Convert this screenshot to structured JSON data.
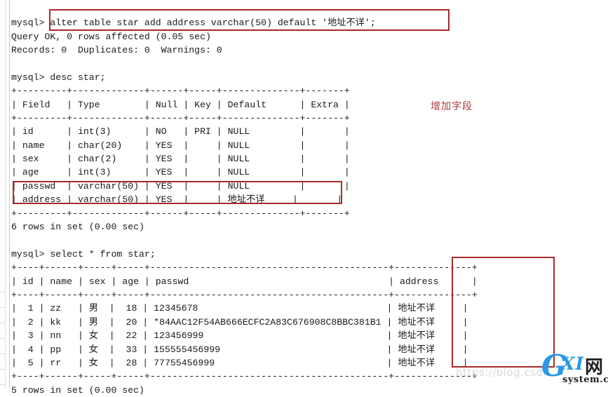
{
  "colors": {
    "background": "#ffffff",
    "text": "#1a1a1a",
    "annotation_red": "#a82a2a",
    "annotation_label": "#b03a3a",
    "watermark_blue": "#2a97e8",
    "watermark_gray": "#d8d8d8"
  },
  "terminal": {
    "lines": [
      "mysql> alter table star add address varchar(50) default '地址不详';",
      "Query OK, 0 rows affected (0.05 sec)",
      "Records: 0  Duplicates: 0  Warnings: 0",
      "",
      "mysql> desc star;",
      "+---------+-------------+------+-----+--------------+-------+",
      "| Field   | Type        | Null | Key | Default      | Extra |",
      "+---------+-------------+------+-----+--------------+-------+",
      "| id      | int(3)      | NO   | PRI | NULL         |       |",
      "| name    | char(20)    | YES  |     | NULL         |       |",
      "| sex     | char(2)     | YES  |     | NULL         |       |",
      "| age     | int(3)      | YES  |     | NULL         |       |",
      "| passwd  | varchar(50) | YES  |     | NULL         |       |",
      "| address | varchar(50) | YES  |     | 地址不详     |       |",
      "+---------+-------------+------+-----+--------------+-------+",
      "6 rows in set (0.00 sec)",
      "",
      "mysql> select * from star;",
      "+----+------+-----+-----+-------------------------------------------+--------------+",
      "| id | name | sex | age | passwd                                    | address      |",
      "+----+------+-----+-----+-------------------------------------------+--------------+",
      "|  1 | zz   | 男  |  18 | 12345678                                  | 地址不详     |",
      "|  2 | kk   | 男  |  20 | *84AAC12F54AB666ECFC2A83C676908C8BBC381B1 | 地址不详     |",
      "|  3 | nn   | 女  |  22 | 123456999                                 | 地址不详     |",
      "|  4 | pp   | 女  |  33 | 155555456999                              | 地址不详     |",
      "|  5 | rr   | 女  |  28 | 77755456999                               | 地址不详     |",
      "+----+------+-----+-----+-------------------------------------------+--------------+",
      "5 rows in set (0.00 sec)"
    ],
    "commands": {
      "alter_statement": "mysql> alter table star add address varchar(50) default '地址不详';",
      "alter_result_1": "Query OK, 0 rows affected (0.05 sec)",
      "alter_result_2": "Records: 0  Duplicates: 0  Warnings: 0",
      "desc_statement": "mysql> desc star;",
      "desc_footer": "6 rows in set (0.00 sec)",
      "select_statement": "mysql> select * from star;",
      "select_footer": "5 rows in set (0.00 sec)"
    },
    "desc_table": {
      "headers": [
        "Field",
        "Type",
        "Null",
        "Key",
        "Default",
        "Extra"
      ],
      "rows": [
        [
          "id",
          "int(3)",
          "NO",
          "PRI",
          "NULL",
          ""
        ],
        [
          "name",
          "char(20)",
          "YES",
          "",
          "NULL",
          ""
        ],
        [
          "sex",
          "char(2)",
          "YES",
          "",
          "NULL",
          ""
        ],
        [
          "age",
          "int(3)",
          "YES",
          "",
          "NULL",
          ""
        ],
        [
          "passwd",
          "varchar(50)",
          "YES",
          "",
          "NULL",
          ""
        ],
        [
          "address",
          "varchar(50)",
          "YES",
          "",
          "地址不详",
          ""
        ]
      ],
      "row_count_text": "6 rows in set (0.00 sec)"
    },
    "select_table": {
      "headers": [
        "id",
        "name",
        "sex",
        "age",
        "passwd",
        "address"
      ],
      "rows": [
        [
          "1",
          "zz",
          "男",
          "18",
          "12345678",
          "地址不详"
        ],
        [
          "2",
          "kk",
          "男",
          "20",
          "*84AAC12F54AB666ECFC2A83C676908C8BBC381B1",
          "地址不详"
        ],
        [
          "3",
          "nn",
          "女",
          "22",
          "123456999",
          "地址不详"
        ],
        [
          "4",
          "pp",
          "女",
          "33",
          "155555456999",
          "地址不详"
        ],
        [
          "5",
          "rr",
          "女",
          "28",
          "77755456999",
          "地址不详"
        ]
      ],
      "row_count_text": "5 rows in set (0.00 sec)"
    }
  },
  "annotations": {
    "add_field_label": "增加字段",
    "boxes": [
      {
        "name": "alter-statement-highlight"
      },
      {
        "name": "address-row-highlight"
      },
      {
        "name": "address-column-highlight"
      }
    ]
  },
  "watermark": {
    "url": "https://blog.csdn.",
    "logo_g": "G",
    "logo_xi": "XI",
    "logo_net": "网",
    "logo_sub": "system.com"
  }
}
